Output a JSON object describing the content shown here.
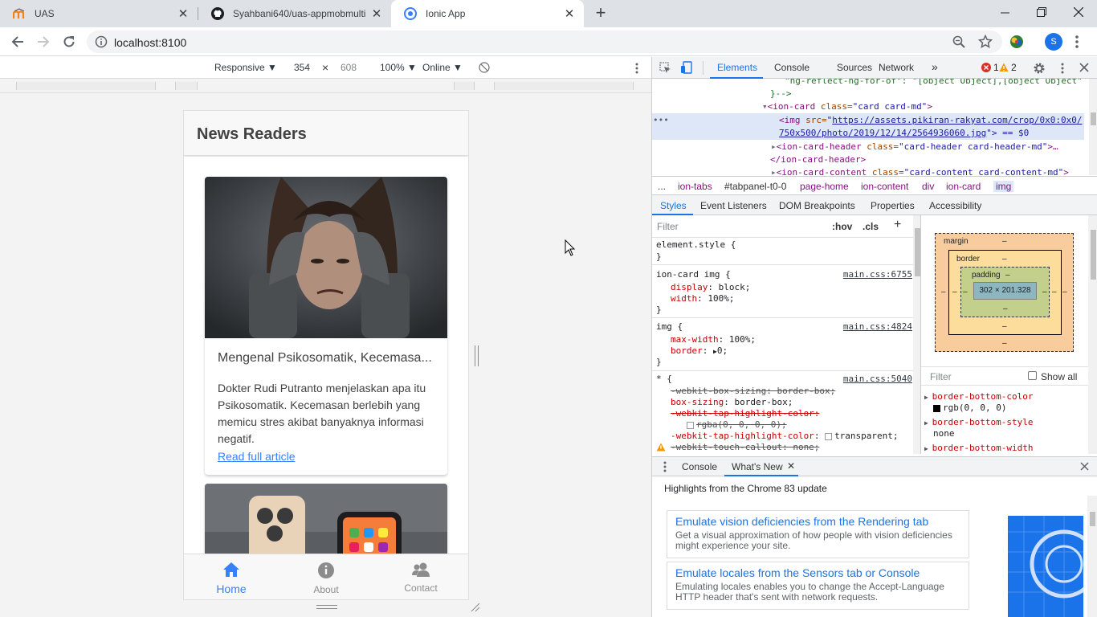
{
  "browser": {
    "tabs": [
      {
        "title": "UAS",
        "icon": "moodle-icon"
      },
      {
        "title": "Syahbani640/uas-appmobmulti",
        "icon": "github-icon"
      },
      {
        "title": "Ionic App",
        "icon": "ionic-icon",
        "active": true
      }
    ],
    "url": "localhost:8100",
    "profile_initial": "S"
  },
  "device_toolbar": {
    "mode": "Responsive ▼",
    "width": "354",
    "times": "×",
    "height": "608",
    "zoom": "100% ▼",
    "network": "Online ▼"
  },
  "app": {
    "header_title": "News Readers",
    "cards": [
      {
        "title": "Mengenal Psikosomatik, Kecemasa...",
        "description": "Dokter Rudi Putranto menjelaskan apa itu Psikosomatik. Kecemasan berlebih yang memicu stres akibat banyaknya informasi negatif.",
        "link": "Read full article"
      }
    ],
    "tabs": [
      {
        "label": "Home",
        "icon": "home-icon",
        "selected": true
      },
      {
        "label": "About",
        "icon": "info-icon",
        "selected": false
      },
      {
        "label": "Contact",
        "icon": "people-icon",
        "selected": false
      }
    ],
    "accent_color": "#3880ff"
  },
  "devtools": {
    "tabs": [
      "Elements",
      "Console",
      "Sources",
      "Network",
      "»"
    ],
    "errors": "1",
    "warnings": "2",
    "dom": {
      "line1": "\"ng-reflect-ng-for-of\": \"[object Object],[object Object\"",
      "line2": "}-->",
      "line3_tag": "<ion-card",
      "line3_attr": " class=",
      "line3_val": "\"card card-md\"",
      "line3_end": ">",
      "sel_tag": "<img",
      "sel_attr": " src=",
      "sel_link1": "https://assets.pikiran-rakyat.com/crop/0x0:0x0/",
      "sel_link2": "750x500/photo/2019/12/14/2564936060.jpg",
      "sel_end": "\"> == $0",
      "line5_tag": "<ion-card-header",
      "line5_attr": " class=",
      "line5_val": "\"card-header card-header-md\"",
      "line5_end": ">…",
      "line6": "</ion-card-header>",
      "line7_tag": "<ion-card-content",
      "line7_attr": " class=",
      "line7_val": "\"card-content card-content-md\"",
      "line7_end": ">"
    },
    "breadcrumbs": [
      "...",
      "ion-tabs",
      "#tabpanel-t0-0",
      "page-home",
      "ion-content",
      "div",
      "ion-card",
      "img"
    ],
    "subtabs": [
      "Styles",
      "Event Listeners",
      "DOM Breakpoints",
      "Properties",
      "Accessibility"
    ],
    "styles": {
      "filter_placeholder": "Filter",
      "hov": ":hov",
      "cls": ".cls",
      "plus": "+",
      "element_style": "element.style {",
      "close": "}",
      "rule1_sel": "ion-card img {",
      "rule1_src": "main.css:6755",
      "rule1_p1": "display",
      "rule1_v1": "block;",
      "rule1_p2": "width",
      "rule1_v2": "100%;",
      "rule2_sel": "img {",
      "rule2_src": "main.css:4824",
      "rule2_p1": "max-width",
      "rule2_v1": "100%;",
      "rule2_p2": "border",
      "rule2_v2": "0;",
      "rule3_sel": "* {",
      "rule3_src": "main.css:5040",
      "rule3_l1": "-webkit-box-sizing: border-box;",
      "rule3_p2": "box-sizing",
      "rule3_v2": "border-box;",
      "rule3_l3": "-webkit-tap-highlight-color:",
      "rule3_l4": "rgba(0, 0, 0, 0);",
      "rule3_p5": "-webkit-tap-highlight-color",
      "rule3_v5": "transparent;",
      "rule3_l6": "-webkit-touch-callout: none;"
    },
    "boxmodel": {
      "margin": "margin",
      "border": "border",
      "padding": "padding",
      "dash": "–",
      "content": "302 × 201.328",
      "filter_placeholder": "Filter",
      "show_all": "Show all",
      "prop1": "border-bottom-color",
      "val1": "rgb(0, 0, 0)",
      "prop2": "border-bottom-style",
      "val2": "none",
      "prop3": "border-bottom-width"
    },
    "drawer": {
      "tabs": [
        "Console",
        "What's New"
      ],
      "highlights": "Highlights from the Chrome 83 update",
      "items": [
        {
          "title": "Emulate vision deficiencies from the Rendering tab",
          "desc": "Get a visual approximation of how people with vision deficiencies might experience your site."
        },
        {
          "title": "Emulate locales from the Sensors tab or Console",
          "desc": "Emulating locales enables you to change the Accept-Language HTTP header that's sent with network requests."
        }
      ]
    }
  }
}
